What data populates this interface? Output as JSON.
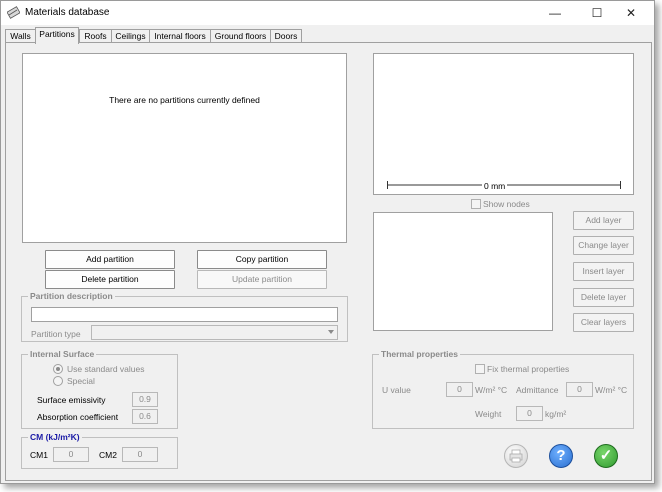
{
  "window": {
    "title": "Materials database",
    "minimize_glyph": "—",
    "maximize_glyph": "☐",
    "close_glyph": "✕"
  },
  "tabs": [
    {
      "label": "Walls"
    },
    {
      "label": "Partitions"
    },
    {
      "label": "Roofs"
    },
    {
      "label": "Ceilings"
    },
    {
      "label": "Internal floors"
    },
    {
      "label": "Ground floors"
    },
    {
      "label": "Doors"
    }
  ],
  "partitions": {
    "empty_message": "There are no partitions currently defined",
    "add_label": "Add partition",
    "copy_label": "Copy partition",
    "delete_label": "Delete partition",
    "update_label": "Update partition"
  },
  "description": {
    "group_title": "Partition description",
    "type_label": "Partition type",
    "description_value": "",
    "type_value": ""
  },
  "preview": {
    "scale_label": "0 mm",
    "show_nodes_label": "Show nodes"
  },
  "layers": {
    "add_label": "Add layer",
    "change_label": "Change layer",
    "insert_label": "Insert layer",
    "delete_label": "Delete layer",
    "clear_label": "Clear layers"
  },
  "internal_surface": {
    "group_title": "Internal Surface",
    "standard_label": "Use standard values",
    "special_label": "Special",
    "emissivity_label": "Surface emissivity",
    "emissivity_value": "0.9",
    "absorption_label": "Absorption coefficient",
    "absorption_value": "0.6"
  },
  "cm": {
    "title": "CM (kJ/m²K)",
    "cm1_label": "CM1",
    "cm1_value": "0",
    "cm2_label": "CM2",
    "cm2_value": "0"
  },
  "thermal": {
    "group_title": "Thermal properties",
    "fix_label": "Fix thermal properties",
    "u_label": "U value",
    "u_value": "0",
    "u_unit": "W/m² °C",
    "admittance_label": "Admittance",
    "admittance_value": "0",
    "admittance_unit": "W/m² °C",
    "weight_label": "Weight",
    "weight_value": "0",
    "weight_unit": "kg/m²"
  },
  "actions": {
    "help_glyph": "?",
    "ok_glyph": "✓"
  },
  "colors": {
    "help_blue": "#2a6fd0",
    "ok_green": "#2f9a2f",
    "cm_title_blue": "#1a1aa6"
  }
}
